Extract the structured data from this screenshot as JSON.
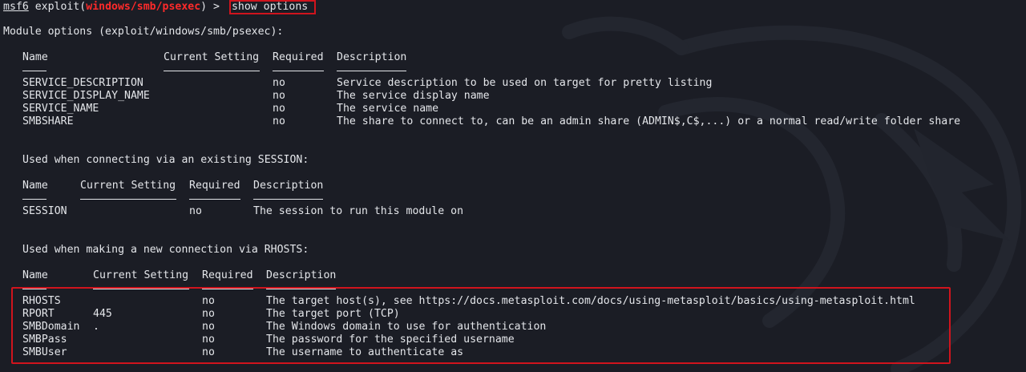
{
  "prompt": {
    "host": "msf6",
    "module_prefix": "exploit(",
    "module_name": "windows/smb/psexec",
    "module_suffix": ") > ",
    "command": "show options"
  },
  "header": "Module options (exploit/windows/smb/psexec):",
  "columns": {
    "name": "Name",
    "current": "Current Setting",
    "required": "Required",
    "description": "Description"
  },
  "table1": {
    "rows": [
      {
        "name": "SERVICE_DESCRIPTION",
        "current": "",
        "required": "no",
        "description": "Service description to be used on target for pretty listing"
      },
      {
        "name": "SERVICE_DISPLAY_NAME",
        "current": "",
        "required": "no",
        "description": "The service display name"
      },
      {
        "name": "SERVICE_NAME",
        "current": "",
        "required": "no",
        "description": "The service name"
      },
      {
        "name": "SMBSHARE",
        "current": "",
        "required": "no",
        "description": "The share to connect to, can be an admin share (ADMIN$,C$,...) or a normal read/write folder share"
      }
    ]
  },
  "section2_title": "Used when connecting via an existing SESSION:",
  "table2": {
    "rows": [
      {
        "name": "SESSION",
        "current": "",
        "required": "no",
        "description": "The session to run this module on"
      }
    ]
  },
  "section3_title": "Used when making a new connection via RHOSTS:",
  "table3": {
    "rows": [
      {
        "name": "RHOSTS",
        "current": "",
        "required": "no",
        "description": "The target host(s), see https://docs.metasploit.com/docs/using-metasploit/basics/using-metasploit.html"
      },
      {
        "name": "RPORT",
        "current": "445",
        "required": "no",
        "description": "The target port (TCP)"
      },
      {
        "name": "SMBDomain",
        "current": ".",
        "required": "no",
        "description": "The Windows domain to use for authentication"
      },
      {
        "name": "SMBPass",
        "current": "",
        "required": "no",
        "description": "The password for the specified username"
      },
      {
        "name": "SMBUser",
        "current": "",
        "required": "no",
        "description": "The username to authenticate as"
      }
    ]
  },
  "colors": {
    "background": "#1b1d25",
    "text": "#e4e6ea",
    "module_name": "#ff2a2a",
    "highlight_box": "#d0141d"
  },
  "decorations": {
    "watermark": "dragon-watermark-icon"
  }
}
